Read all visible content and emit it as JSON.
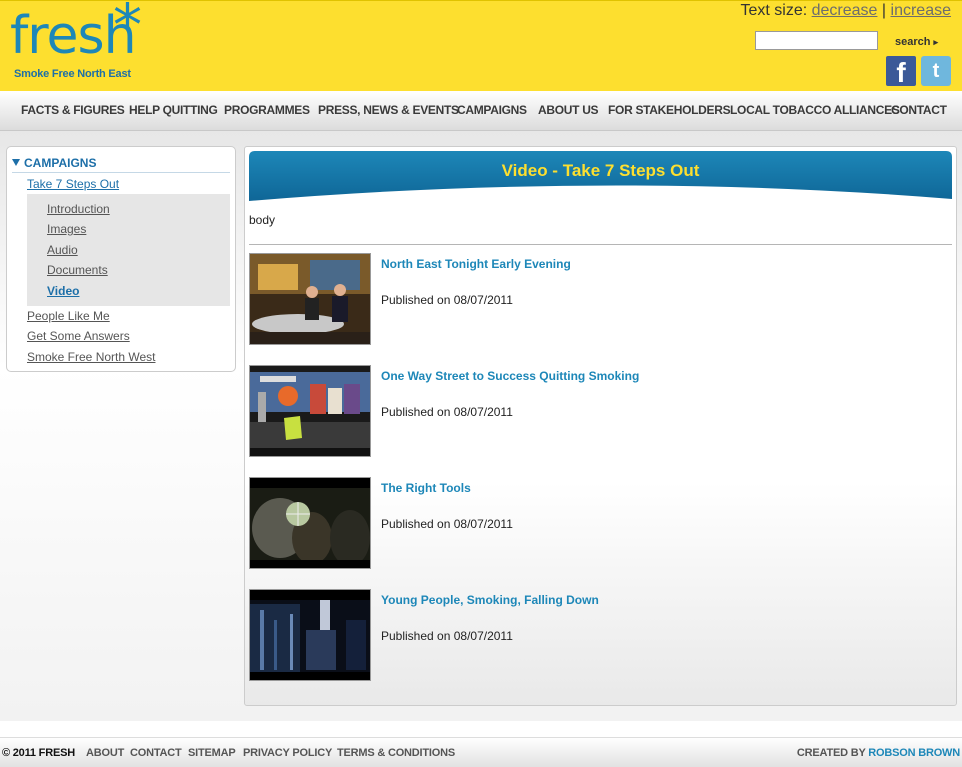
{
  "header": {
    "logo_word": "fresh",
    "logo_star": "*",
    "logo_tagline": "Smoke Free North East",
    "text_size_label": "Text size:",
    "decrease_label": "decrease",
    "separator": "|",
    "increase_label": "increase",
    "search_placeholder": "",
    "search_button": "search",
    "search_arrow": "▸",
    "facebook_glyph": "f",
    "twitter_glyph": "t"
  },
  "nav": {
    "items": [
      {
        "label": "FACTS & FIGURES"
      },
      {
        "label": "HELP QUITTING"
      },
      {
        "label": "PROGRAMMES"
      },
      {
        "label": "PRESS, NEWS & EVENTS"
      },
      {
        "label": "CAMPAIGNS"
      },
      {
        "label": "ABOUT US"
      },
      {
        "label": "FOR STAKEHOLDERS"
      },
      {
        "label": "LOCAL TOBACCO ALLIANCES"
      },
      {
        "label": "CONTACT"
      }
    ]
  },
  "sidebar": {
    "heading": "CAMPAIGNS",
    "current": "Take 7 Steps Out",
    "sub_items": [
      {
        "label": "Introduction"
      },
      {
        "label": "Images"
      },
      {
        "label": "Audio"
      },
      {
        "label": "Documents"
      },
      {
        "label": "Video"
      }
    ],
    "other_items": [
      {
        "label": "People Like Me"
      },
      {
        "label": "Get Some Answers"
      },
      {
        "label": "Smoke Free North West"
      }
    ]
  },
  "main": {
    "title": "Video - Take 7 Steps Out",
    "body_text": "body",
    "videos": [
      {
        "title": "North East Tonight Early Evening",
        "published": "Published on 08/07/2011",
        "thumb": "news-studio"
      },
      {
        "title": "One Way Street to Success Quitting Smoking",
        "published": "Published on 08/07/2011",
        "thumb": "street-scene"
      },
      {
        "title": "The Right Tools",
        "published": "Published on 08/07/2011",
        "thumb": "person-close-up"
      },
      {
        "title": "Young People, Smoking, Falling Down",
        "published": "Published on 08/07/2011",
        "thumb": "dark-urban"
      }
    ]
  },
  "footer": {
    "copyright": "© 2011 FRESH",
    "links": [
      {
        "label": "ABOUT"
      },
      {
        "label": "CONTACT"
      },
      {
        "label": "SITEMAP"
      },
      {
        "label": "PRIVACY POLICY"
      },
      {
        "label": "TERMS & CONDITIONS"
      }
    ],
    "credit_prefix": "CREATED BY",
    "credit_name": "ROBSON BROWN"
  },
  "colors": {
    "brand_yellow": "#fddf2f",
    "brand_blue": "#1d87b8",
    "dark_blue": "#1d6fa8"
  }
}
